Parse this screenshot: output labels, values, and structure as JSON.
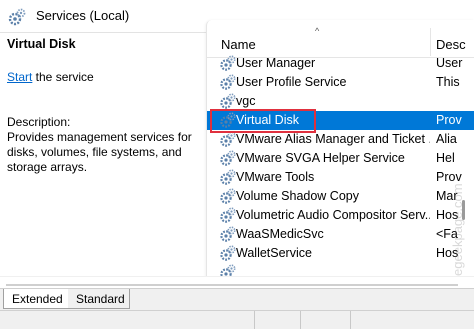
{
  "window": {
    "title": "Services (Local)",
    "icon": "services-gear-icon"
  },
  "detail": {
    "service_name": "Virtual Disk",
    "start_link": "Start",
    "start_suffix": " the service",
    "description_label": "Description:",
    "description_text": "Provides management services for disks, volumes, file systems, and storage arrays."
  },
  "list": {
    "sort_indicator": "^",
    "columns": {
      "name": "Name",
      "description": "Desc"
    },
    "rows": [
      {
        "name": "User Manager",
        "desc": "User"
      },
      {
        "name": "User Profile Service",
        "desc": "This"
      },
      {
        "name": "vgc",
        "desc": ""
      },
      {
        "name": "Virtual Disk",
        "desc": "Prov"
      },
      {
        "name": "VMware Alias Manager and Ticket ...",
        "desc": "Alia"
      },
      {
        "name": "VMware SVGA Helper Service",
        "desc": "Hel"
      },
      {
        "name": "VMware Tools",
        "desc": "Prov"
      },
      {
        "name": "Volume Shadow Copy",
        "desc": "Mar"
      },
      {
        "name": "Volumetric Audio Compositor Serv...",
        "desc": "Hos"
      },
      {
        "name": "WaaSMedicSvc",
        "desc": "<Fa"
      },
      {
        "name": "WalletService",
        "desc": "Hos"
      },
      {
        "name": "",
        "desc": ""
      }
    ],
    "selected_index": 3
  },
  "tabs": {
    "extended": "Extended",
    "standard": "Standard",
    "active": "extended"
  },
  "watermark": "@thegeekpage.com",
  "colors": {
    "selection": "#0078d7",
    "highlight_box": "#e0303e",
    "link": "#0066cc"
  }
}
